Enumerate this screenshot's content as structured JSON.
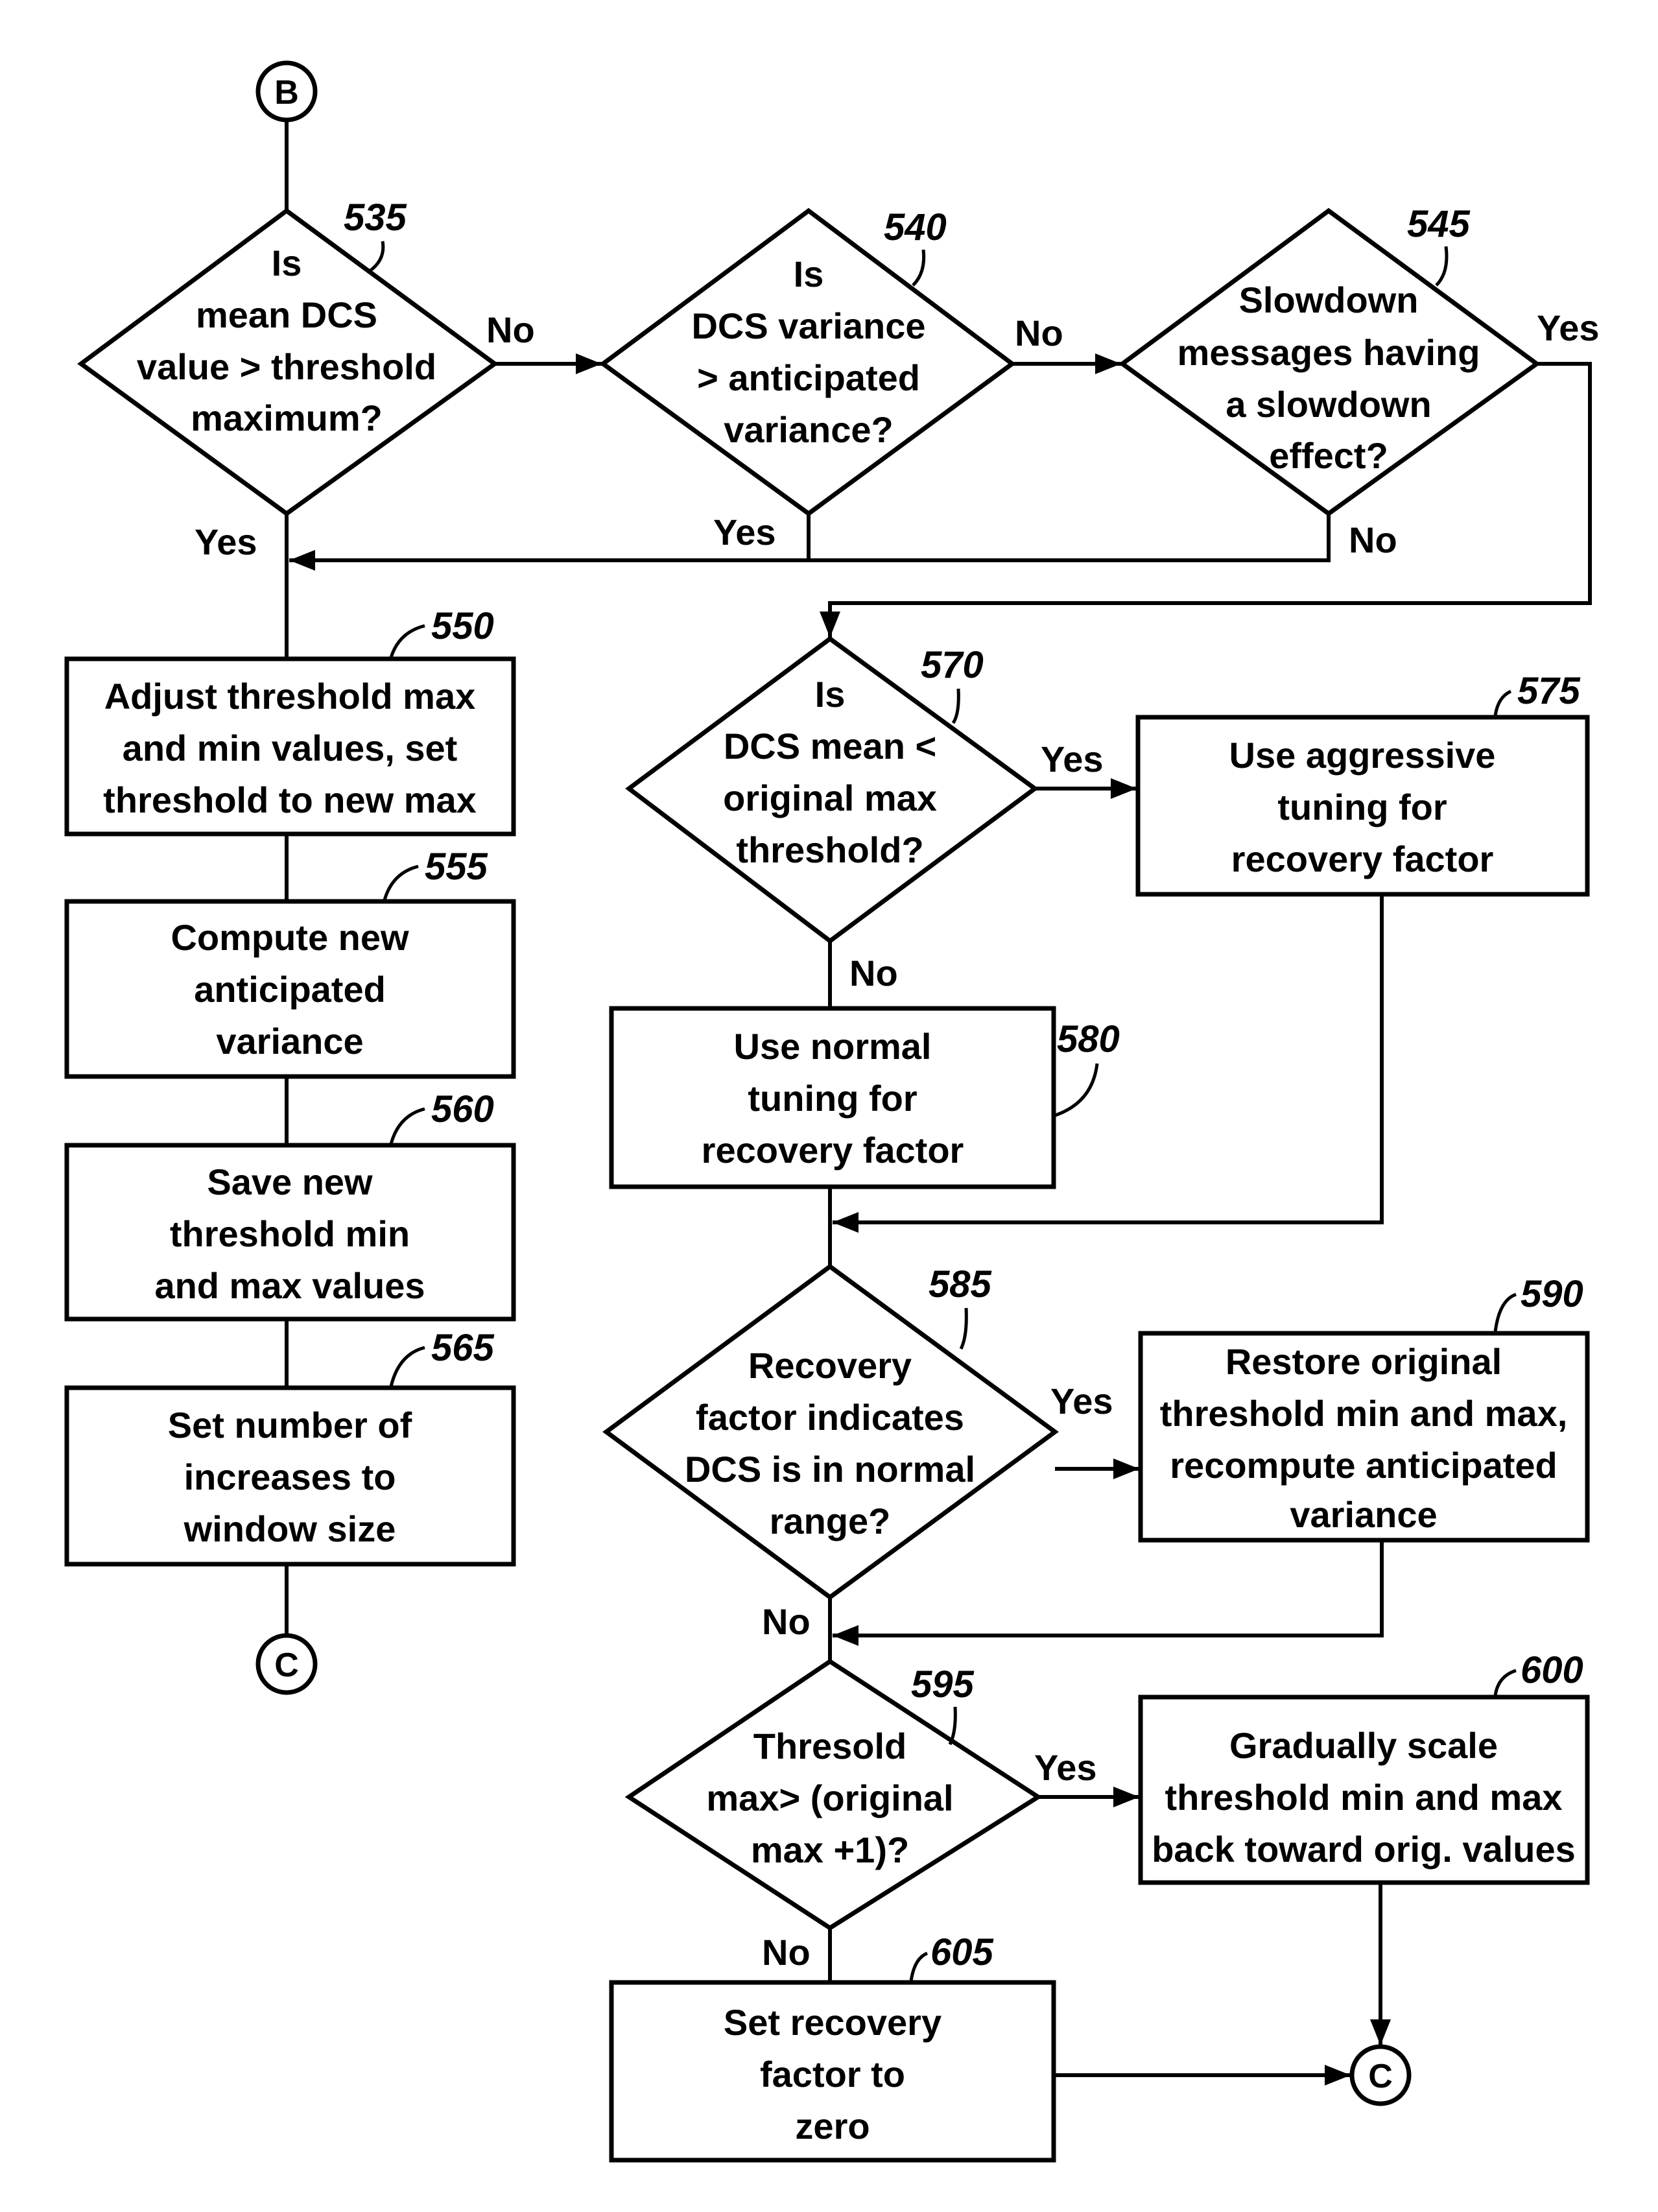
{
  "connectors": {
    "start": "B",
    "end_left": "C",
    "end_right": "C"
  },
  "nodes": {
    "d535": {
      "ref": "535",
      "lines": [
        "Is",
        "mean DCS",
        "value > threshold",
        "maximum?"
      ]
    },
    "d540": {
      "ref": "540",
      "lines": [
        "Is",
        "DCS variance",
        "> anticipated",
        "variance?"
      ]
    },
    "d545": {
      "ref": "545",
      "lines": [
        "Slowdown",
        "messages having",
        "a slowdown",
        "effect?"
      ]
    },
    "b550": {
      "ref": "550",
      "lines": [
        "Adjust threshold max",
        "and min values, set",
        "threshold to new max"
      ]
    },
    "b555": {
      "ref": "555",
      "lines": [
        "Compute new",
        "anticipated",
        "variance"
      ]
    },
    "b560": {
      "ref": "560",
      "lines": [
        "Save new",
        "threshold min",
        "and max values"
      ]
    },
    "b565": {
      "ref": "565",
      "lines": [
        "Set number of",
        "increases to",
        "window size"
      ]
    },
    "d570": {
      "ref": "570",
      "lines": [
        "Is",
        "DCS mean <",
        "original max",
        "threshold?"
      ]
    },
    "b575": {
      "ref": "575",
      "lines": [
        "Use aggressive",
        "tuning for",
        "recovery factor"
      ]
    },
    "b580": {
      "ref": "580",
      "lines": [
        "Use normal",
        "tuning for",
        "recovery factor"
      ]
    },
    "d585": {
      "ref": "585",
      "lines": [
        "Recovery",
        "factor indicates",
        "DCS is in normal",
        "range?"
      ]
    },
    "b590": {
      "ref": "590",
      "lines": [
        "Restore original",
        "threshold min and max,",
        "recompute anticipated",
        "variance"
      ]
    },
    "d595": {
      "ref": "595",
      "lines": [
        "Thresold",
        "max> (original",
        "max +1)?"
      ]
    },
    "b600": {
      "ref": "600",
      "lines": [
        "Gradually scale",
        "threshold min and max",
        "back toward orig. values"
      ]
    },
    "b605": {
      "ref": "605",
      "lines": [
        "Set recovery",
        "factor to",
        "zero"
      ]
    }
  },
  "edge_labels": {
    "d535_no": "No",
    "d535_yes": "Yes",
    "d540_no": "No",
    "d540_yes": "Yes",
    "d545_yes": "Yes",
    "d545_no": "No",
    "d570_yes": "Yes",
    "d570_no": "No",
    "d585_yes": "Yes",
    "d585_no": "No",
    "d595_yes": "Yes",
    "d595_no": "No"
  }
}
